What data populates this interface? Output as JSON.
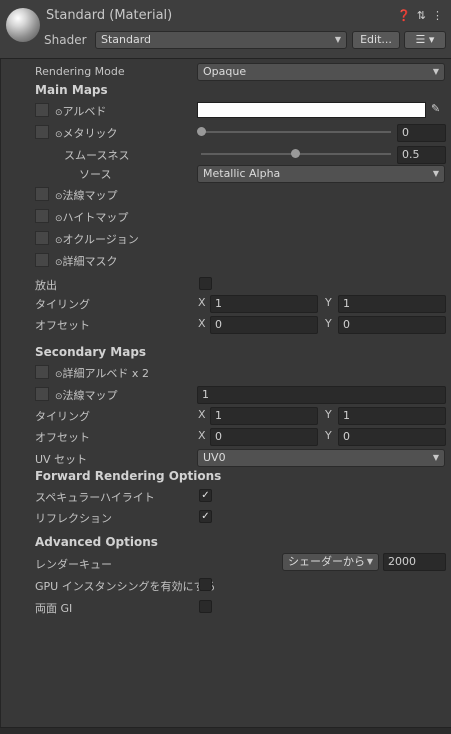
{
  "header": {
    "title": "Standard (Material)",
    "shader_label": "Shader",
    "shader_value": "Standard",
    "edit_button": "Edit...",
    "icons": [
      "help-icon",
      "preset-icon",
      "kebab-icon",
      "list-icon"
    ]
  },
  "rendering_mode": {
    "label": "Rendering Mode",
    "value": "Opaque"
  },
  "main_maps": {
    "title": "Main Maps",
    "albedo_label": "アルベド",
    "albedo_color": "#ffffff",
    "metallic_label": "メタリック",
    "metallic_value": "0",
    "metallic_fraction": 0.0,
    "smoothness_label": "スムースネス",
    "smoothness_value": "0.5",
    "smoothness_fraction": 0.5,
    "source_label": "ソース",
    "source_value": "Metallic Alpha",
    "normal_label": "法線マップ",
    "height_label": "ハイトマップ",
    "occlusion_label": "オクルージョン",
    "detail_mask_label": "詳細マスク",
    "emission_label": "放出",
    "tiling_label": "タイリング",
    "tiling_x": "1",
    "tiling_y": "1",
    "offset_label": "オフセット",
    "offset_x": "0",
    "offset_y": "0"
  },
  "secondary_maps": {
    "title": "Secondary Maps",
    "detail_albedo_label": "詳細アルベド x 2",
    "normal_label": "法線マップ",
    "normal_value": "1",
    "tiling_label": "タイリング",
    "tiling_x": "1",
    "tiling_y": "1",
    "offset_label": "オフセット",
    "offset_x": "0",
    "offset_y": "0",
    "uv_label": "UV セット",
    "uv_value": "UV0"
  },
  "forward": {
    "title": "Forward Rendering Options",
    "specular_label": "スペキュラーハイライト",
    "specular_checked": true,
    "reflection_label": "リフレクション",
    "reflection_checked": true
  },
  "advanced": {
    "title": "Advanced Options",
    "queue_label": "レンダーキュー",
    "queue_mode": "シェーダーから",
    "queue_value": "2000",
    "gpu_label": "GPU インスタンシングを有効にする",
    "double_gi_label": "両面 GI"
  },
  "axis": {
    "x": "X",
    "y": "Y"
  },
  "check_glyph": "✓",
  "circle_glyph": "⊙"
}
